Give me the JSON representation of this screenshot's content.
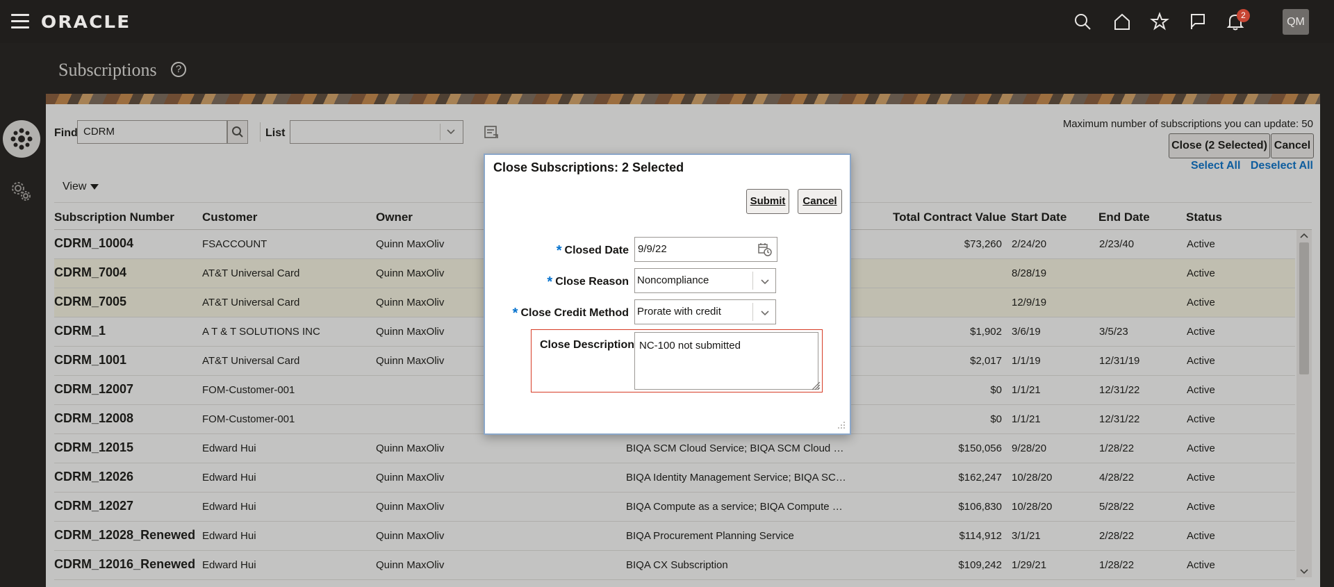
{
  "header": {
    "logo": "ORACLE",
    "notifications_count": "2",
    "avatar_initials": "QM"
  },
  "page": {
    "title": "Subscriptions",
    "help_glyph": "?"
  },
  "toolbar": {
    "find_label": "Find",
    "find_value": "CDRM",
    "list_label": "List",
    "list_value": "",
    "max_note": "Maximum number of subscriptions you can update: 50",
    "close_selected_label": "Close (2 Selected)",
    "cancel_label": "Cancel",
    "select_all_label": "Select All",
    "deselect_all_label": "Deselect All",
    "view_label": "View"
  },
  "table": {
    "columns": [
      "Subscription Number",
      "Customer",
      "Owner",
      "Total Contract Value",
      "Start Date",
      "End Date",
      "Status"
    ],
    "rows": [
      {
        "number": "CDRM_10004",
        "customer": "FSACCOUNT",
        "owner": "Quinn MaxOliv",
        "product": "",
        "value": "$73,260",
        "start": "2/24/20",
        "end": "2/23/40",
        "status": "Active",
        "selected": false
      },
      {
        "number": "CDRM_7004",
        "customer": "AT&T Universal Card",
        "owner": "Quinn MaxOliv",
        "product": "",
        "value": "",
        "start": "8/28/19",
        "end": "",
        "status": "Active",
        "selected": true
      },
      {
        "number": "CDRM_7005",
        "customer": "AT&T Universal Card",
        "owner": "Quinn MaxOliv",
        "product": "",
        "value": "",
        "start": "12/9/19",
        "end": "",
        "status": "Active",
        "selected": true
      },
      {
        "number": "CDRM_1",
        "customer": "A T & T SOLUTIONS INC",
        "owner": "Quinn MaxOliv",
        "product": "",
        "value": "$1,902",
        "start": "3/6/19",
        "end": "3/5/23",
        "status": "Active",
        "selected": false
      },
      {
        "number": "CDRM_1001",
        "customer": "AT&T Universal Card",
        "owner": "Quinn MaxOliv",
        "product": "",
        "value": "$2,017",
        "start": "1/1/19",
        "end": "12/31/19",
        "status": "Active",
        "selected": false
      },
      {
        "number": "CDRM_12007",
        "customer": "FOM-Customer-001",
        "owner": "",
        "product": "",
        "value": "$0",
        "start": "1/1/21",
        "end": "12/31/22",
        "status": "Active",
        "selected": false
      },
      {
        "number": "CDRM_12008",
        "customer": "FOM-Customer-001",
        "owner": "",
        "product": "",
        "value": "$0",
        "start": "1/1/21",
        "end": "12/31/22",
        "status": "Active",
        "selected": false
      },
      {
        "number": "CDRM_12015",
        "customer": "Edward Hui",
        "owner": "Quinn MaxOliv",
        "product": "BIQA SCM Cloud Service; BIQA SCM Cloud …",
        "value": "$150,056",
        "start": "9/28/20",
        "end": "1/28/22",
        "status": "Active",
        "selected": false
      },
      {
        "number": "CDRM_12026",
        "customer": "Edward Hui",
        "owner": "Quinn MaxOliv",
        "product": "BIQA Identity Management Service; BIQA SC…",
        "value": "$162,247",
        "start": "10/28/20",
        "end": "4/28/22",
        "status": "Active",
        "selected": false
      },
      {
        "number": "CDRM_12027",
        "customer": "Edward Hui",
        "owner": "Quinn MaxOliv",
        "product": "BIQA Compute as a service; BIQA Compute …",
        "value": "$106,830",
        "start": "10/28/20",
        "end": "5/28/22",
        "status": "Active",
        "selected": false
      },
      {
        "number": "CDRM_12028_Renewed",
        "customer": "Edward Hui",
        "owner": "Quinn MaxOliv",
        "product": "BIQA Procurement Planning Service",
        "value": "$114,912",
        "start": "3/1/21",
        "end": "2/28/22",
        "status": "Active",
        "selected": false
      },
      {
        "number": "CDRM_12016_Renewed",
        "customer": "Edward Hui",
        "owner": "Quinn MaxOliv",
        "product": "BIQA CX Subscription",
        "value": "$109,242",
        "start": "1/29/21",
        "end": "1/28/22",
        "status": "Active",
        "selected": false
      }
    ]
  },
  "dialog": {
    "title": "Close Subscriptions: 2 Selected",
    "submit_label": "Submit",
    "cancel_label": "Cancel",
    "required_marker": "*",
    "closed_date_label": "Closed Date",
    "closed_date_value": "9/9/22",
    "close_reason_label": "Close Reason",
    "close_reason_value": "Noncompliance",
    "close_credit_label": "Close Credit Method",
    "close_credit_value": "Prorate with credit",
    "close_description_label": "Close Description",
    "close_description_value": "NC-100 not submitted"
  },
  "colors": {
    "header_bg": "#201e1c",
    "accent_link": "#0572ce",
    "notification_badge": "#c74634",
    "selected_row": "#fbf9e6",
    "error_border": "#d63b25"
  }
}
